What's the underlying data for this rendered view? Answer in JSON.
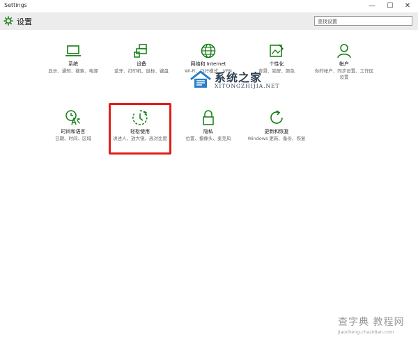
{
  "window": {
    "title": "Settings",
    "minimize_glyph": "—",
    "maximize_glyph": "☐",
    "close_glyph": "✕"
  },
  "header": {
    "title": "设置",
    "icon": "gear-icon",
    "search_value": "查找设置"
  },
  "accent_color": "#107c10",
  "highlight_color": "#e31c1c",
  "tiles": [
    {
      "icon": "laptop-icon",
      "label": "系统",
      "desc": "显示、通知、搜索、电源"
    },
    {
      "icon": "devices-icon",
      "label": "设备",
      "desc": "蓝牙、打印机、鼠标、键盘"
    },
    {
      "icon": "globe-icon",
      "label": "网络和 Internet",
      "desc": "Wi-Fi、飞行模式、VPN"
    },
    {
      "icon": "personalization-icon",
      "label": "个性化",
      "desc": "背景、锁屏、颜色"
    },
    {
      "icon": "person-icon",
      "label": "帐户",
      "desc": "你的帐户、同步设置、工作区设置"
    },
    {
      "icon": "time-language-icon",
      "label": "时间和语言",
      "desc": "日期、时间、区域"
    },
    {
      "icon": "ease-of-access-icon",
      "label": "轻松使用",
      "desc": "讲述人、放大镜、高对比度"
    },
    {
      "icon": "lock-icon",
      "label": "隐私",
      "desc": "位置、摄像头、麦克风"
    },
    {
      "icon": "update-icon",
      "label": "更新和恢复",
      "desc": "Windows 更新、备份、恢复"
    }
  ],
  "watermark_center": {
    "title": "系统之家",
    "subtitle": "XITONGZHIJIA.NET"
  },
  "watermark_corner": {
    "title": "查字典 教程网",
    "url": "jiaocheng.chazidian.com"
  }
}
